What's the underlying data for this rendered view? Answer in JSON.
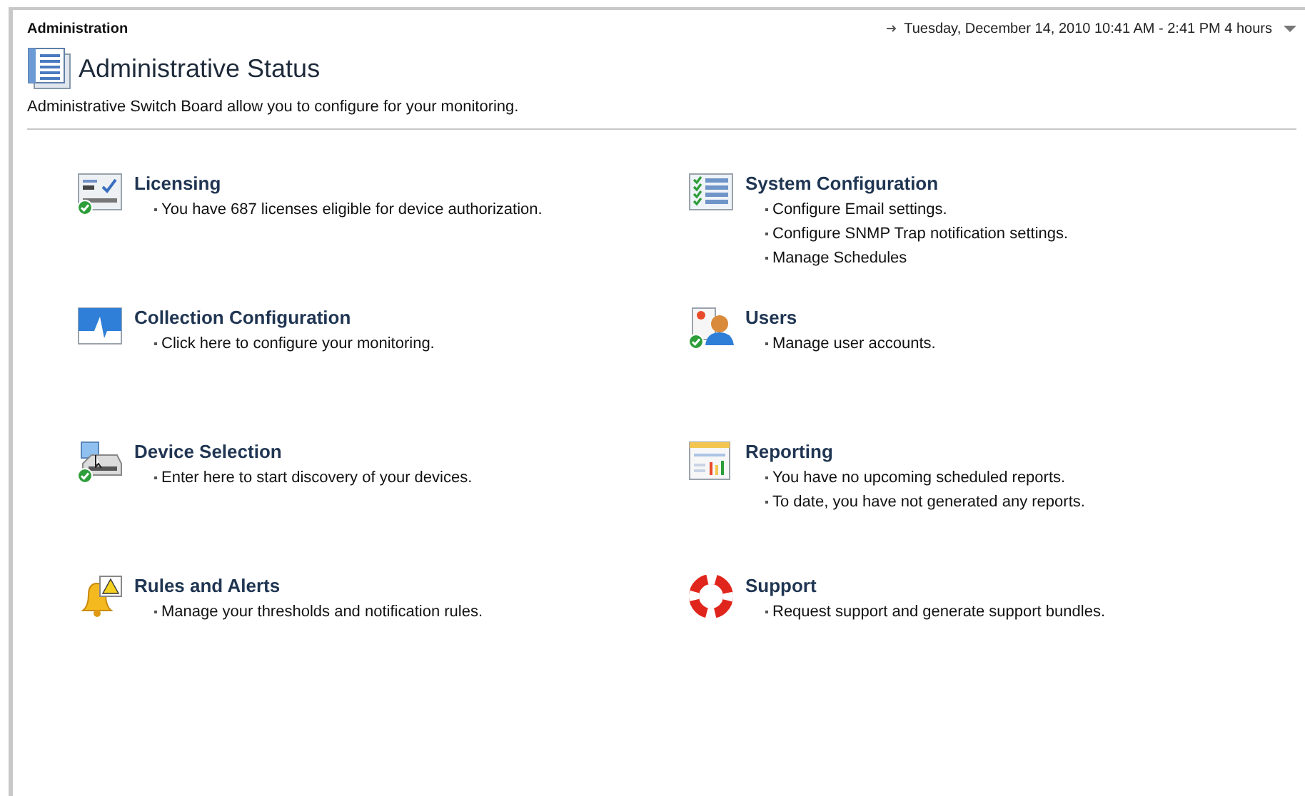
{
  "header": {
    "title": "Administration",
    "time_range": "Tuesday, December 14, 2010 10:41 AM - 2:41 PM 4 hours"
  },
  "page": {
    "title": "Administrative Status",
    "description": "Administrative Switch Board allow you to configure for your monitoring."
  },
  "sections": [
    {
      "title": "Licensing",
      "ok": true,
      "items": [
        "You have 687 licenses eligible for device authorization."
      ]
    },
    {
      "title": "System Configuration",
      "ok": false,
      "items": [
        "Configure Email settings.",
        "Configure SNMP Trap notification settings.",
        "Manage Schedules"
      ]
    },
    {
      "title": "Collection Configuration",
      "ok": false,
      "items": [
        "Click here to configure your monitoring."
      ]
    },
    {
      "title": "Users",
      "ok": true,
      "items": [
        "Manage user accounts."
      ]
    },
    {
      "title": "Device Selection",
      "ok": true,
      "items": [
        "Enter here to start discovery of your devices."
      ]
    },
    {
      "title": "Reporting",
      "ok": false,
      "items": [
        "You have no upcoming scheduled reports.",
        "To date, you have not generated any reports."
      ]
    },
    {
      "title": "Rules and Alerts",
      "ok": false,
      "items": [
        "Manage your thresholds and notification rules."
      ]
    },
    {
      "title": "Support",
      "ok": false,
      "items": [
        "Request support and generate support bundles."
      ]
    }
  ]
}
